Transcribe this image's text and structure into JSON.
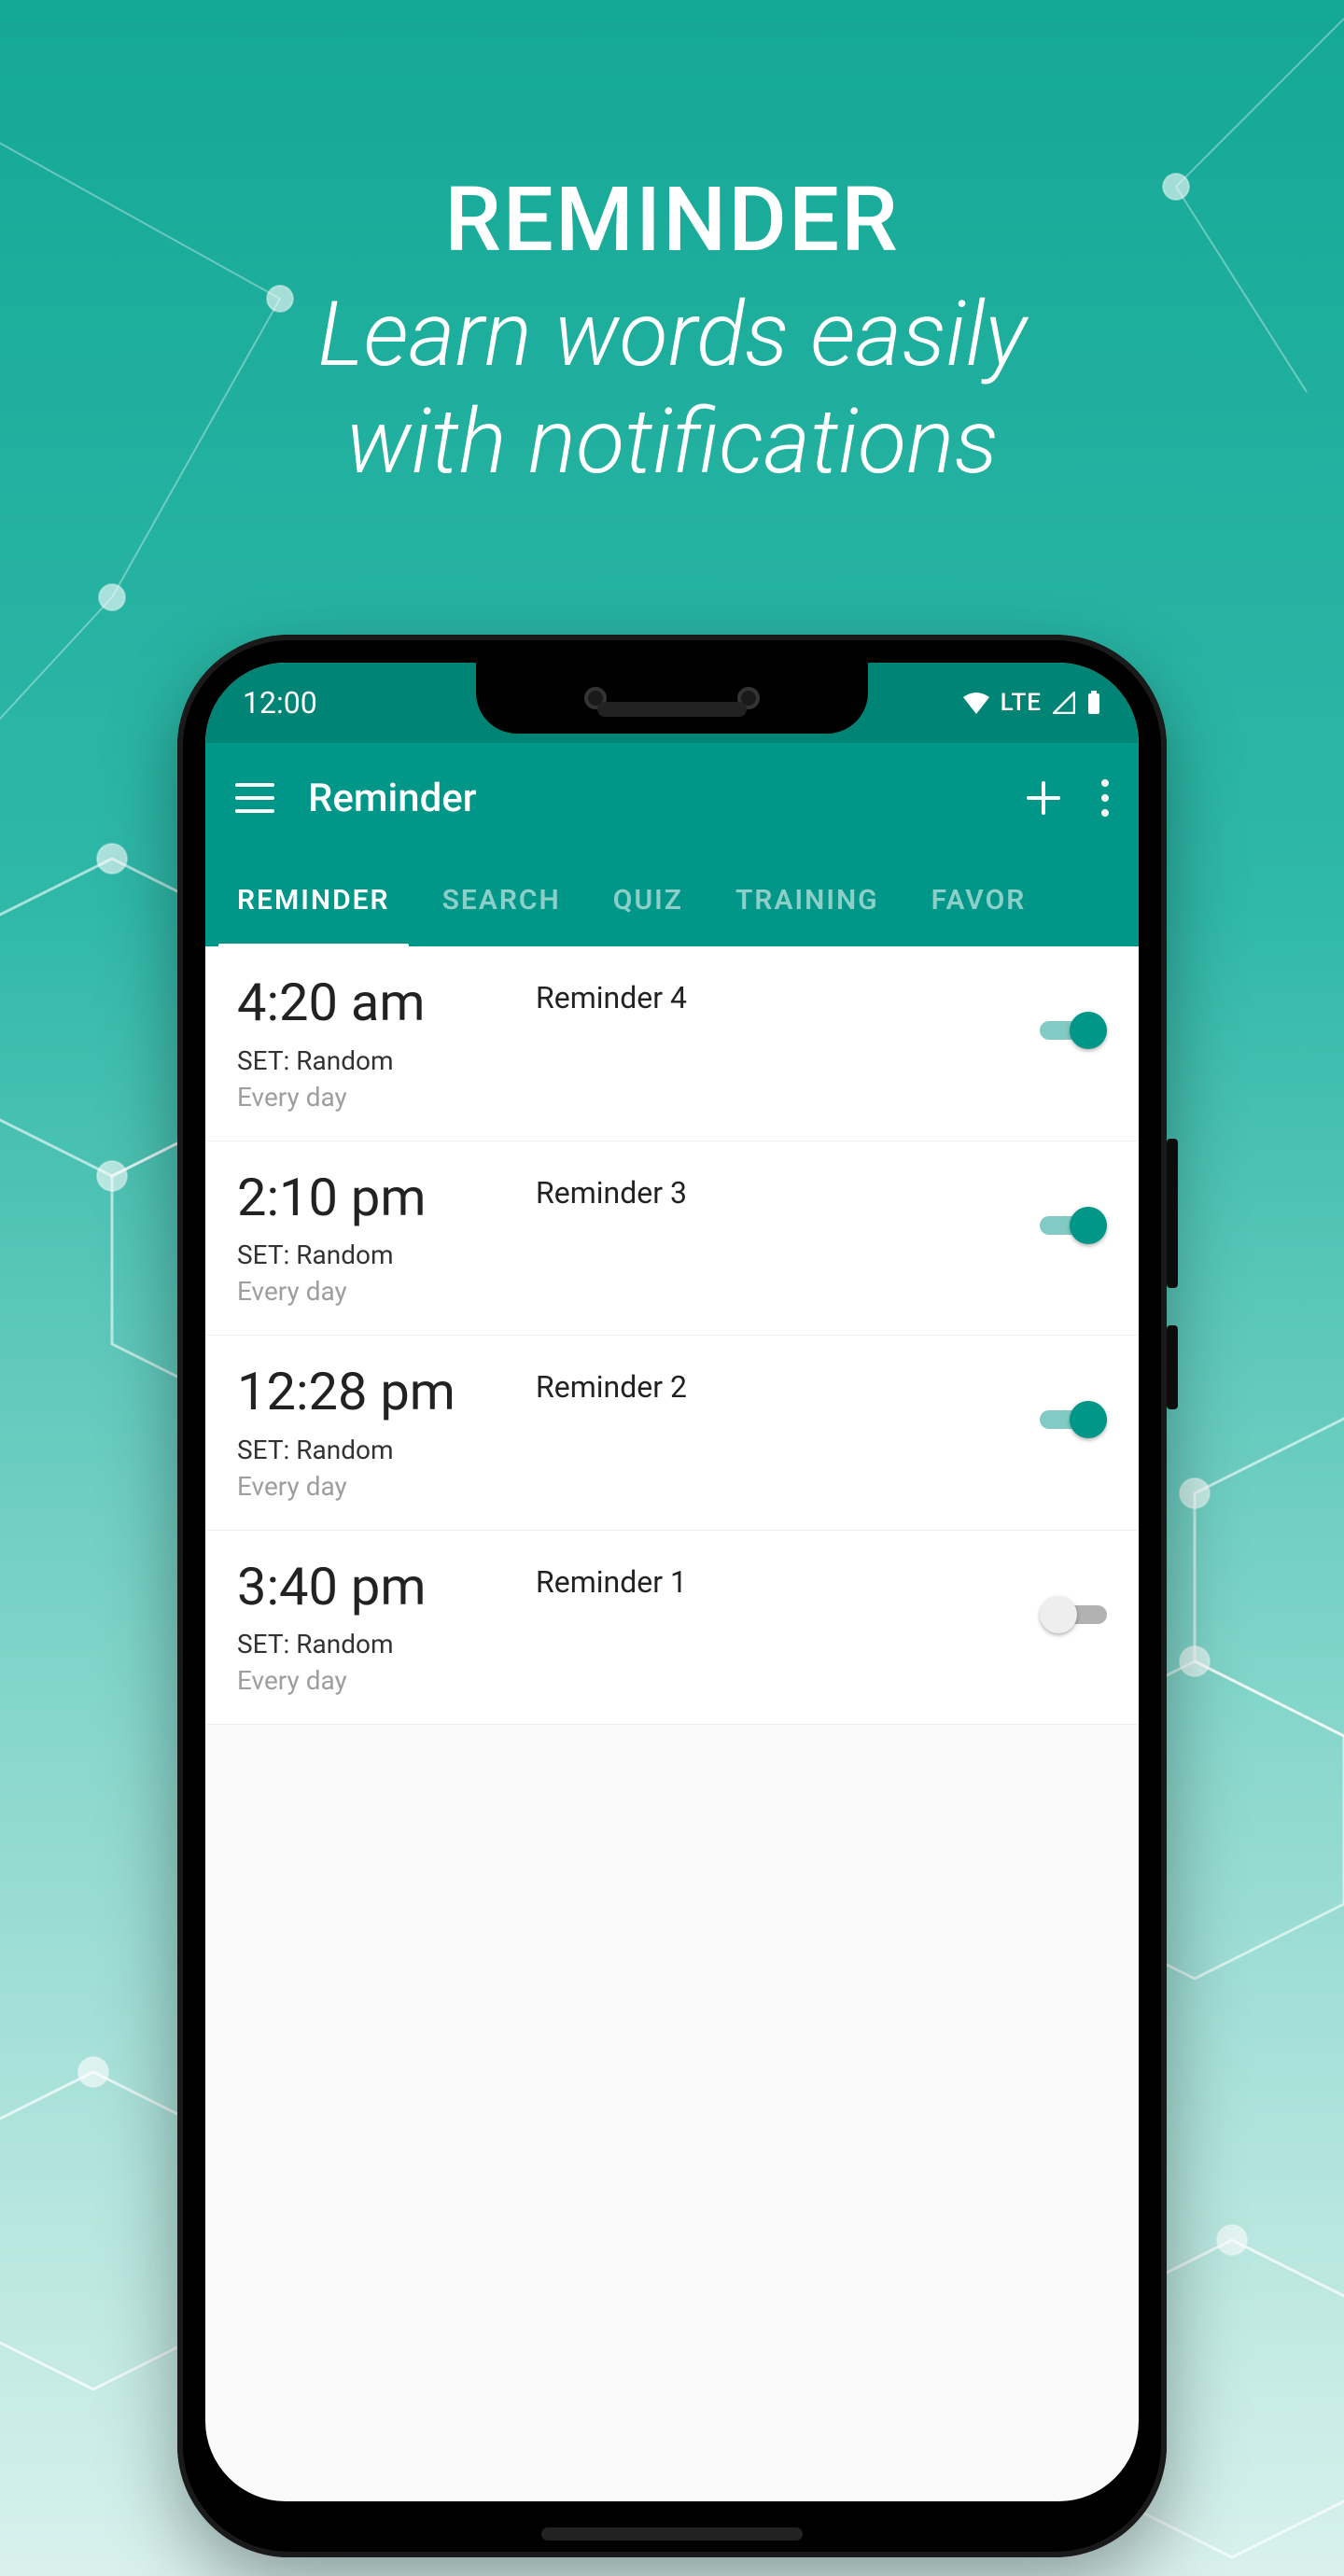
{
  "promo": {
    "title": "REMINDER",
    "subtitle_line1": "Learn words easily",
    "subtitle_line2": "with notifications"
  },
  "statusbar": {
    "time": "12:00",
    "network": "LTE"
  },
  "appbar": {
    "title": "Reminder"
  },
  "tabs": [
    {
      "label": "REMINDER",
      "active": true
    },
    {
      "label": "SEARCH",
      "active": false
    },
    {
      "label": "QUIZ",
      "active": false
    },
    {
      "label": "TRAINING",
      "active": false
    },
    {
      "label": "FAVOR",
      "active": false
    }
  ],
  "reminders": [
    {
      "time": "4:20 am",
      "name": "Reminder 4",
      "set": "SET: Random",
      "days": "Every day",
      "enabled": true
    },
    {
      "time": "2:10 pm",
      "name": "Reminder 3",
      "set": "SET: Random",
      "days": "Every day",
      "enabled": true
    },
    {
      "time": "12:28 pm",
      "name": "Reminder 2",
      "set": "SET: Random",
      "days": "Every day",
      "enabled": true
    },
    {
      "time": "3:40 pm",
      "name": "Reminder 1",
      "set": "SET: Random",
      "days": "Every day",
      "enabled": false
    }
  ]
}
